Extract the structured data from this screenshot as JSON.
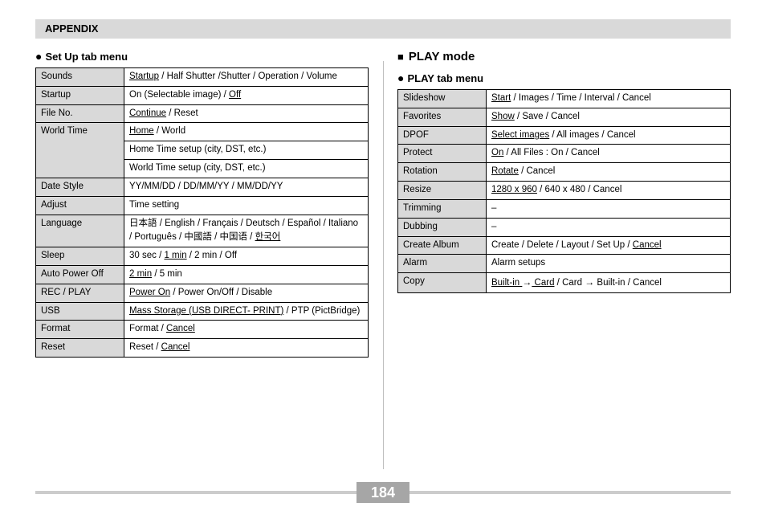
{
  "header": "APPENDIX",
  "left": {
    "heading": "Set Up tab menu",
    "rows": [
      {
        "label": "Sounds",
        "cells": [
          "<span class='u'>Startup</span> / Half Shutter /Shutter / Operation / Volume"
        ]
      },
      {
        "label": "Startup",
        "cells": [
          "On (Selectable image) / <span class='u'>Off</span>"
        ]
      },
      {
        "label": "File No.",
        "cells": [
          "<span class='u'>Continue</span> / Reset"
        ]
      },
      {
        "label": "World Time",
        "cells": [
          "<span class='u'>Home</span> / World",
          "Home Time setup (city, DST, etc.)",
          "World Time setup (city, DST, etc.)"
        ]
      },
      {
        "label": "Date Style",
        "cells": [
          "YY/MM/DD / DD/MM/YY / MM/DD/YY"
        ]
      },
      {
        "label": "Adjust",
        "cells": [
          "Time setting"
        ]
      },
      {
        "label": "Language",
        "cells": [
          "日本語 / English / Français / Deutsch / Español / Italiano / Português / 中國語 / 中国语 / <span class='u'>한국어</span>"
        ]
      },
      {
        "label": "Sleep",
        "cells": [
          "30 sec / <span class='u'>1 min</span> / 2 min / Off"
        ]
      },
      {
        "label": "Auto Power Off",
        "cells": [
          "<span class='u'>2 min</span> / 5 min"
        ]
      },
      {
        "label": "REC / PLAY",
        "cells": [
          "<span class='u'>Power On</span> / Power On/Off / Disable"
        ]
      },
      {
        "label": "USB",
        "cells": [
          "<span class='u'>Mass Storage (USB DIRECT- PRINT)</span> / PTP (PictBridge)"
        ]
      },
      {
        "label": "Format",
        "cells": [
          "Format / <span class='u'>Cancel</span>"
        ]
      },
      {
        "label": "Reset",
        "cells": [
          "Reset / <span class='u'>Cancel</span>"
        ]
      }
    ]
  },
  "right": {
    "mode": "PLAY mode",
    "heading": "PLAY tab menu",
    "rows": [
      {
        "label": "Slideshow",
        "cells": [
          "<span class='u'>Start</span> / Images / Time / Interval / Cancel"
        ]
      },
      {
        "label": "Favorites",
        "cells": [
          "<span class='u'>Show</span> / Save / Cancel"
        ]
      },
      {
        "label": "DPOF",
        "cells": [
          "<span class='u'>Select images</span> / All images / Cancel"
        ]
      },
      {
        "label": "Protect",
        "cells": [
          "<span class='u'>On</span> / All Files : On / Cancel"
        ]
      },
      {
        "label": "Rotation",
        "cells": [
          "<span class='u'>Rotate</span> / Cancel"
        ]
      },
      {
        "label": "Resize",
        "cells": [
          "<span class='u'>1280 x 960</span> / 640 x 480 / Cancel"
        ]
      },
      {
        "label": "Trimming",
        "cells": [
          "–"
        ]
      },
      {
        "label": "Dubbing",
        "cells": [
          "–"
        ]
      },
      {
        "label": "Create Album",
        "cells": [
          "Create / Delete / Layout / Set Up / <span class='u'>Cancel</span>"
        ]
      },
      {
        "label": "Alarm",
        "cells": [
          "Alarm setups"
        ]
      },
      {
        "label": "Copy",
        "cells": [
          "<span class='u'>Built-in <span class='arrow'>→</span> Card</span> / Card <span class='arrow'>→</span>  Built-in / Cancel"
        ]
      }
    ]
  },
  "page": "184"
}
